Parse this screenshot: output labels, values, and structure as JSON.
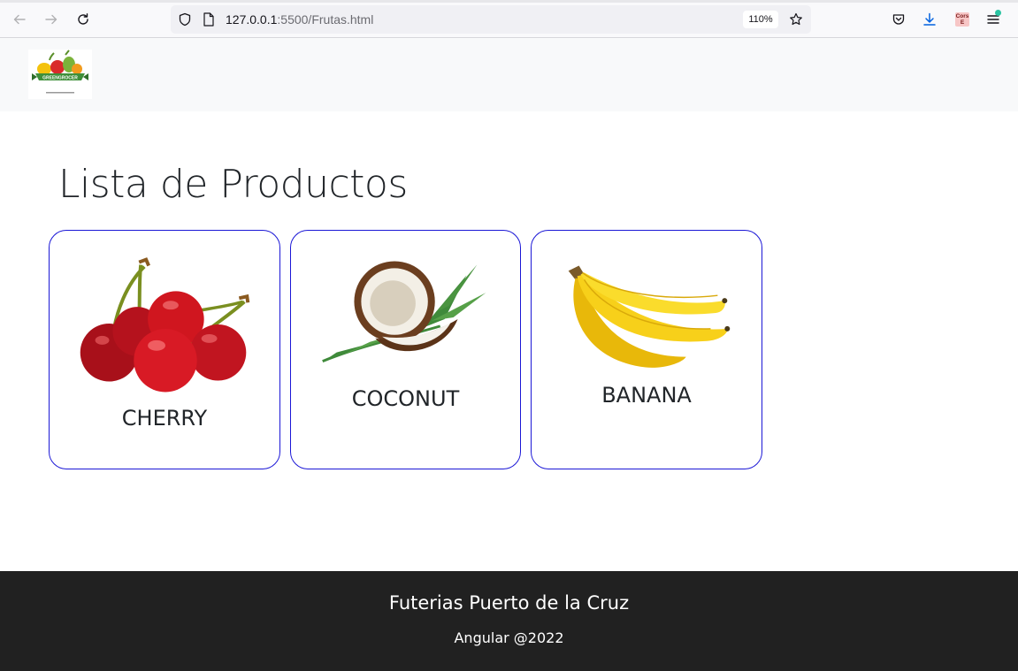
{
  "browser": {
    "url_host": "127.0.0.1",
    "url_rest": ":5500/Frutas.html",
    "zoom": "110%",
    "cors_label": "Cors E"
  },
  "header": {
    "logo_text": "GREENGROCER"
  },
  "main": {
    "title": "Lista de Productos",
    "products": [
      {
        "name": "CHERRY"
      },
      {
        "name": "COCONUT"
      },
      {
        "name": "BANANA"
      }
    ]
  },
  "footer": {
    "title": "Futerias Puerto de la Cruz",
    "subtitle": "Angular @2022"
  },
  "colors": {
    "card_border": "#1b17d6",
    "footer_bg": "#212121",
    "header_bg": "#f8f9fa"
  }
}
